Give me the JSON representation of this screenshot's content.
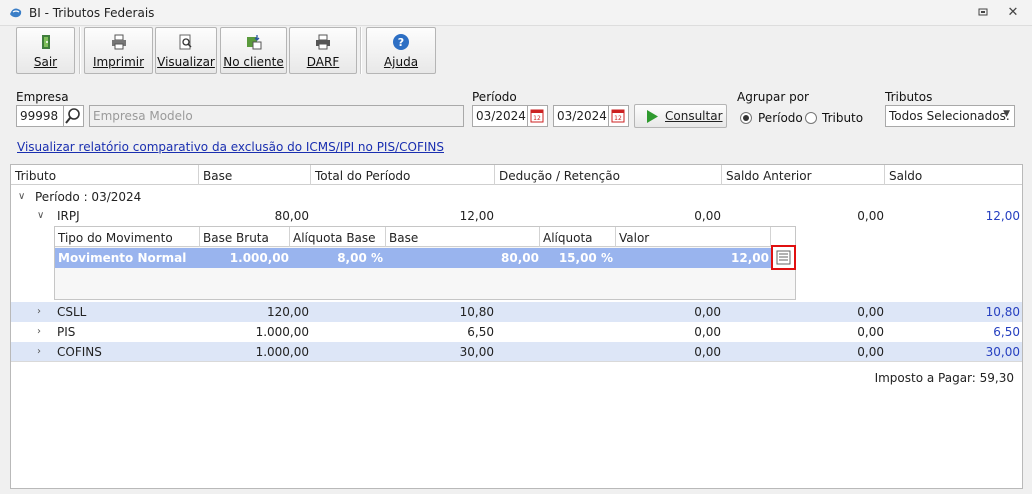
{
  "window": {
    "title": "BI - Tributos Federais"
  },
  "toolbar": {
    "sair": "Sair",
    "imprimir": "Imprimir",
    "visualizar": "Visualizar",
    "no_cliente": "No cliente",
    "darf": "DARF",
    "ajuda": "Ajuda"
  },
  "form": {
    "empresa_label": "Empresa",
    "empresa_code": "99998",
    "empresa_name": "Empresa Modelo",
    "periodo_label": "Período",
    "periodo_start": "03/2024",
    "periodo_end": "03/2024",
    "consultar": "Consultar",
    "agrupar_label": "Agrupar por",
    "agrupar_periodo": "Período",
    "agrupar_tributo": "Tributo",
    "tributos_label": "Tributos",
    "tributos_value": "Todos Selecionados."
  },
  "link_relatorio": "Visualizar relatório comparativo da exclusão do ICMS/IPI no PIS/COFINS",
  "grid": {
    "headers": [
      "Tributo",
      "Base",
      "Total do Período",
      "Dedução / Retenção",
      "Saldo Anterior",
      "Saldo"
    ],
    "group_label": "Período : 03/2024",
    "rows": [
      {
        "tributo": "IRPJ",
        "base": "80,00",
        "total": "12,00",
        "deducao": "0,00",
        "saldo_anterior": "0,00",
        "saldo": "12,00"
      },
      {
        "tributo": "CSLL",
        "base": "120,00",
        "total": "10,80",
        "deducao": "0,00",
        "saldo_anterior": "0,00",
        "saldo": "10,80"
      },
      {
        "tributo": "PIS",
        "base": "1.000,00",
        "total": "6,50",
        "deducao": "0,00",
        "saldo_anterior": "0,00",
        "saldo": "6,50"
      },
      {
        "tributo": "COFINS",
        "base": "1.000,00",
        "total": "30,00",
        "deducao": "0,00",
        "saldo_anterior": "0,00",
        "saldo": "30,00"
      }
    ],
    "detail": {
      "headers": [
        "Tipo do Movimento",
        "Base Bruta",
        "Alíquota Base",
        "Base",
        "Alíquota",
        "Valor"
      ],
      "row": {
        "tipo": "Movimento Normal",
        "base_bruta": "1.000,00",
        "aliquota_base": "8,00 %",
        "base": "80,00",
        "aliquota": "15,00 %",
        "valor": "12,00"
      }
    },
    "footer": "Imposto a Pagar: 59,30"
  },
  "colors": {
    "selected_row": "#99b4ee",
    "alt_row": "#dde6f7",
    "link": "#1a2fb0",
    "highlight_box": "#e01010"
  }
}
